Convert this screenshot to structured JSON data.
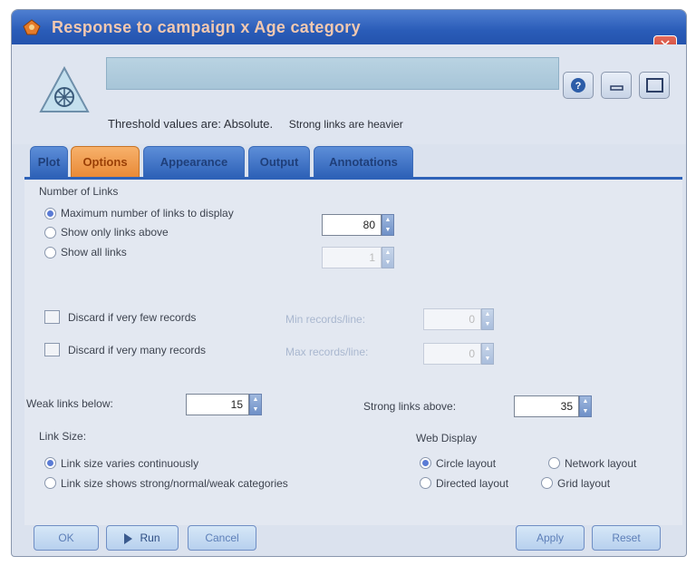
{
  "window": {
    "title": "Response to campaign x Age category",
    "close_glyph": "✕",
    "icon": "web-node-icon"
  },
  "header": {
    "threshold_text": "Threshold values are: Absolute.",
    "links_text": "Strong links are heavier",
    "buttons": [
      "help-icon",
      "minimize-icon",
      "maximize-icon"
    ]
  },
  "tabs": [
    {
      "label": "Plot",
      "active": false
    },
    {
      "label": "Options",
      "active": true
    },
    {
      "label": "Appearance",
      "active": false
    },
    {
      "label": "Output",
      "active": false
    },
    {
      "label": "Annotations",
      "active": false
    }
  ],
  "options": {
    "number_of_links": {
      "section_label": "Number of Links",
      "max_links_label": "Maximum number of links to display",
      "max_links_value": "80",
      "max_links_selected": true,
      "show_above_label": "Show only links above",
      "show_above_value": "1",
      "show_all_label": "Show all links"
    },
    "discard": {
      "few_label": "Discard if very few records",
      "few_field_label": "Min records/line:",
      "few_value": "0",
      "many_label": "Discard if very many records",
      "many_field_label": "Max records/line:",
      "many_value": "0"
    },
    "weak_links_label": "Weak links below:",
    "weak_links_value": "15",
    "strong_links_label": "Strong links above:",
    "strong_links_value": "35",
    "link_size": {
      "section_label": "Link Size:",
      "continuous_label": "Link size varies continuously",
      "categories_label": "Link size shows strong/normal/weak categories",
      "selected": "continuous"
    },
    "web_display": {
      "section_label": "Web Display",
      "circle_label": "Circle layout",
      "network_label": "Network layout",
      "directed_label": "Directed layout",
      "grid_label": "Grid layout",
      "selected": "circle"
    }
  },
  "footer": {
    "ok_label": "OK",
    "run_label": "Run",
    "cancel_label": "Cancel",
    "apply_label": "Apply",
    "reset_label": "Reset"
  },
  "colors": {
    "title_bar": "#2a5cb8",
    "active_tab": "#e98a37",
    "tab": "#2e62b8",
    "panel": "#e3e8f1"
  }
}
